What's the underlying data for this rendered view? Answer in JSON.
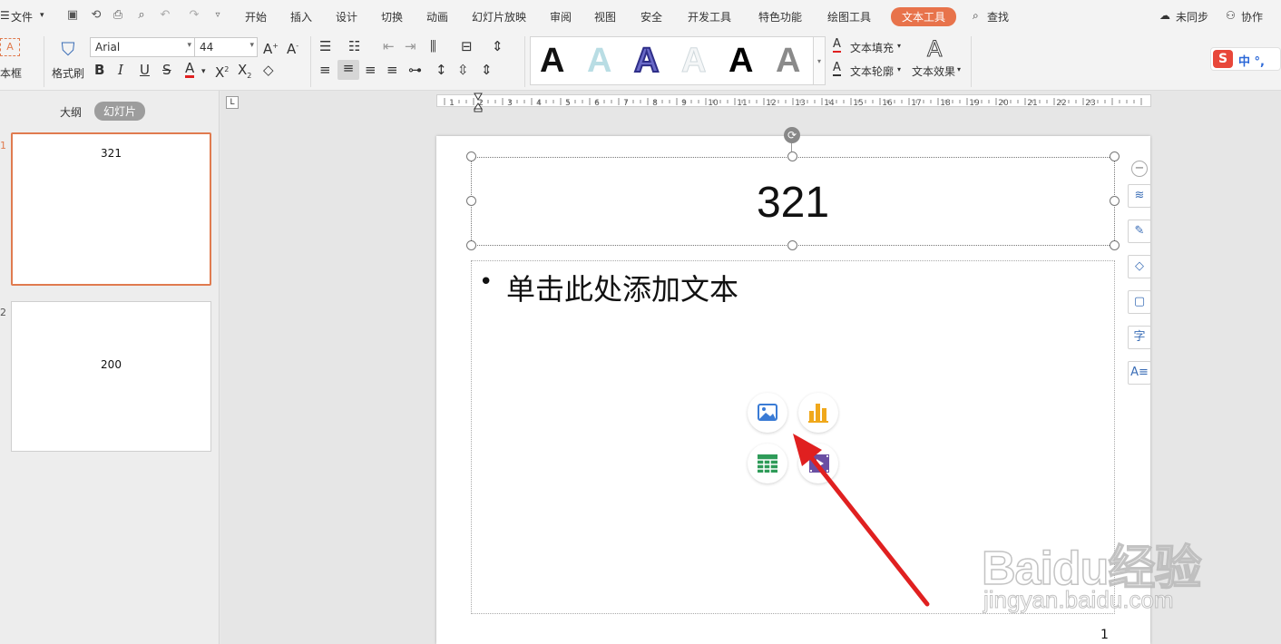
{
  "menubar": {
    "file": "文件",
    "tabs": [
      "开始",
      "插入",
      "设计",
      "切换",
      "动画",
      "幻灯片放映",
      "审阅",
      "视图",
      "安全",
      "开发工具",
      "特色功能",
      "绘图工具",
      "文本工具"
    ],
    "search": "查找",
    "sync": "未同步",
    "collab": "协作"
  },
  "ribbon": {
    "textbox_label": "本框",
    "format_painter": "格式刷",
    "font_name": "Arial",
    "font_size": "44",
    "text_fill": "文本填充",
    "text_outline": "文本轮廓",
    "text_effect": "文本效果",
    "style_letter": "A",
    "ime": "中 °,"
  },
  "panel": {
    "outline_tab": "大纲",
    "slides_tab": "幻灯片",
    "thumbs": [
      {
        "text": "321"
      },
      {
        "text": "200"
      }
    ]
  },
  "ruler": {
    "ticks": [
      "1",
      "2",
      "3",
      "4",
      "5",
      "6",
      "7",
      "8",
      "9",
      "10",
      "11",
      "12",
      "13",
      "14",
      "15",
      "16",
      "17",
      "18",
      "19",
      "20",
      "21",
      "22",
      "23"
    ]
  },
  "slide": {
    "title": "321",
    "body_placeholder": "单击此处添加文本",
    "page_number": "1"
  },
  "watermark": {
    "line1": "Baidu经验",
    "line2": "jingyan.baidu.com"
  },
  "colors": {
    "accent": "#e8734b",
    "selection": "#e07b4f",
    "arrow": "#e02020"
  }
}
